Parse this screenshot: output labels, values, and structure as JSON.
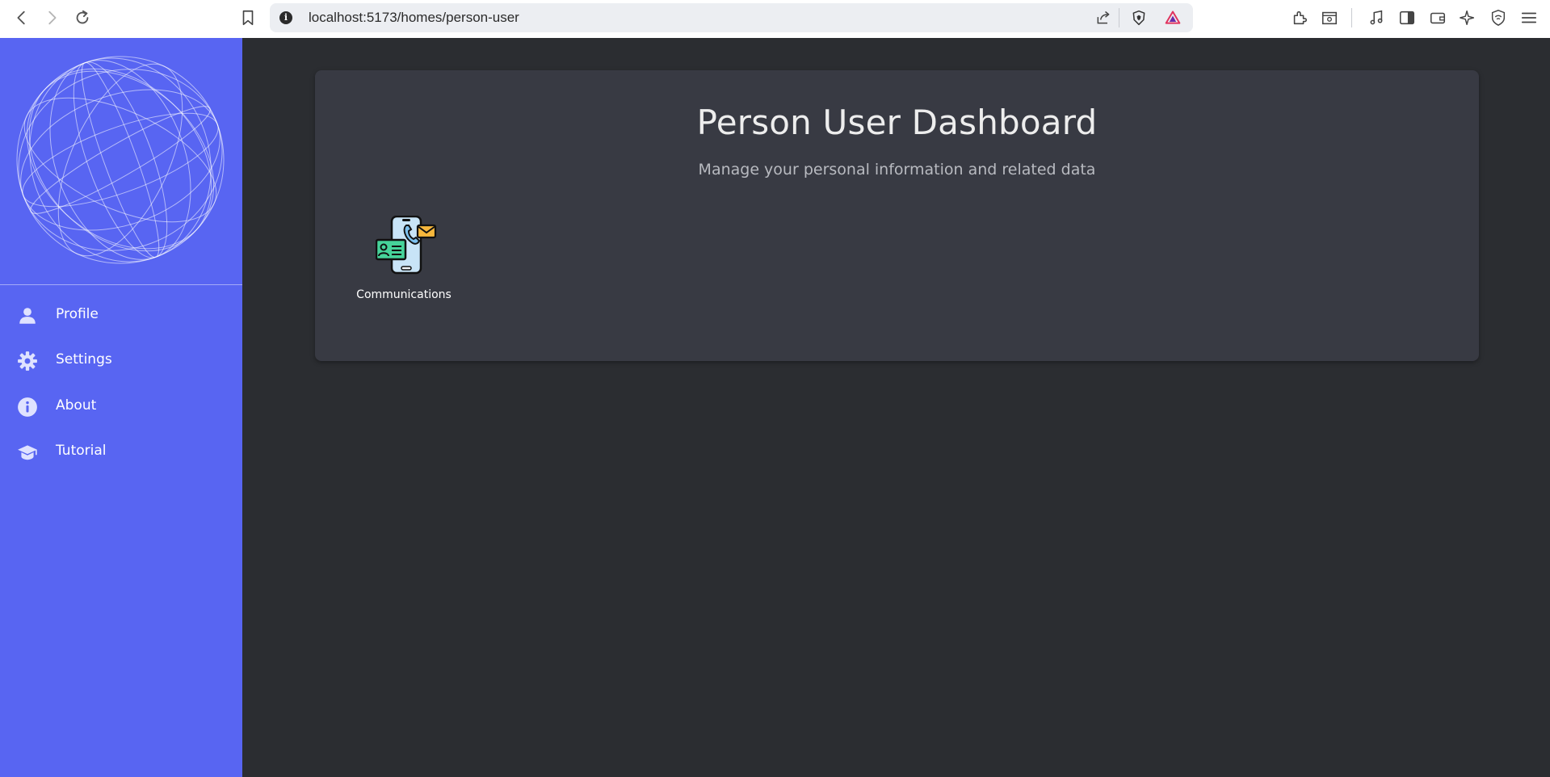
{
  "browser": {
    "url_host": "localhost",
    "url_rest": ":5173/homes/person-user"
  },
  "sidebar": {
    "logo": "globe-logo",
    "items": [
      {
        "label": "Profile",
        "icon": "user-icon"
      },
      {
        "label": "Settings",
        "icon": "gear-icon"
      },
      {
        "label": "About",
        "icon": "info-icon"
      },
      {
        "label": "Tutorial",
        "icon": "graduation-cap-icon"
      }
    ]
  },
  "dashboard": {
    "title": "Person User Dashboard",
    "subtitle": "Manage your personal information and related data",
    "tiles": [
      {
        "label": "Communications",
        "icon": "communications-icon"
      }
    ]
  },
  "colors": {
    "sidebar_bg": "#5865f2",
    "main_bg": "#2b2d31",
    "card_bg": "#383a43"
  }
}
